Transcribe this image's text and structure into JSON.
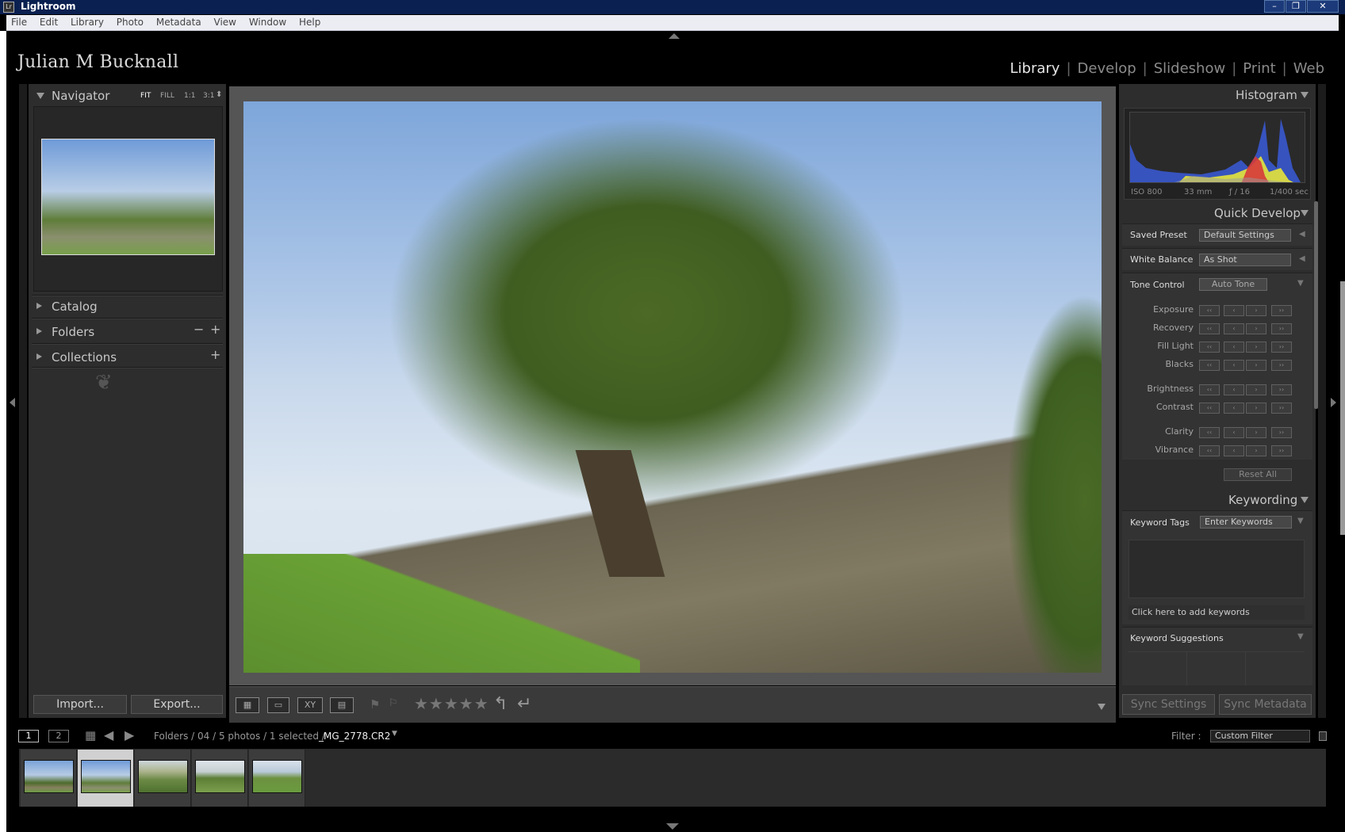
{
  "window": {
    "title": "Lightroom",
    "app_icon": "Lr",
    "controls": [
      "minimize-icon",
      "restore-icon",
      "close-icon"
    ]
  },
  "menu": [
    "File",
    "Edit",
    "Library",
    "Photo",
    "Metadata",
    "View",
    "Window",
    "Help"
  ],
  "identity_plate": "Julian M Bucknall",
  "modules": {
    "library": "Library",
    "develop": "Develop",
    "slideshow": "Slideshow",
    "print": "Print",
    "web": "Web"
  },
  "left_panel": {
    "navigator": {
      "title": "Navigator",
      "options": [
        "FIT",
        "FILL",
        "1:1",
        "3:1"
      ]
    },
    "sections": [
      {
        "label": "Catalog"
      },
      {
        "label": "Folders"
      },
      {
        "label": "Collections"
      }
    ],
    "import_label": "Import...",
    "export_label": "Export..."
  },
  "toolbar": {
    "stars": "★★★★★"
  },
  "right_panel": {
    "histogram": {
      "title": "Histogram",
      "iso": "ISO 800",
      "focal": "33 mm",
      "aperture": "ƒ / 16",
      "shutter": "1/400 sec"
    },
    "quick_develop": {
      "title": "Quick Develop",
      "saved_preset_label": "Saved Preset",
      "saved_preset_value": "Default Settings",
      "white_balance_label": "White Balance",
      "white_balance_value": "As Shot",
      "tone_control_label": "Tone Control",
      "auto_tone_label": "Auto Tone",
      "sliders": [
        "Exposure",
        "Recovery",
        "Fill Light",
        "Blacks",
        "Brightness",
        "Contrast",
        "Clarity",
        "Vibrance"
      ],
      "reset_label": "Reset All"
    },
    "keywording": {
      "title": "Keywording",
      "tags_label": "Keyword Tags",
      "tags_value": "Enter Keywords",
      "add_placeholder": "Click here to add keywords",
      "suggestions_label": "Keyword Suggestions"
    },
    "sync_settings_label": "Sync Settings",
    "sync_metadata_label": "Sync Metadata"
  },
  "filmstrip": {
    "screen1": "1",
    "screen2": "2",
    "path": "Folders / 04 / 5 photos / 1 selected /",
    "filename": "_MG_2778.CR2",
    "filter_label": "Filter :",
    "filter_value": "Custom Filter",
    "thumbs": 5,
    "selected_index": 1
  },
  "colors": {
    "background": "#000000",
    "panel": "#2d2d2d",
    "workspace": "#555555",
    "selected_thumb": "#d0d0d0"
  }
}
